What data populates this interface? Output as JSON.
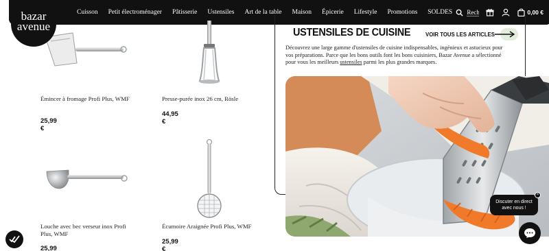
{
  "logo": {
    "line1": "bazar",
    "line2": "avenue"
  },
  "nav": {
    "items": [
      "Cuisson",
      "Petit électroménager",
      "Pâtisserie",
      "Ustensiles",
      "Art de la table",
      "Maison",
      "Épicerie",
      "Lifestyle",
      "Promotions",
      "SOLDES"
    ],
    "search_placeholder": "Rechercher",
    "cart_total": "0,00 €"
  },
  "products": [
    {
      "name": "Émincer à fromage Profi Plus, WMF",
      "price": "25,99 €"
    },
    {
      "name": "Presse-purée inox 26 cm, Rösle",
      "price": "44,95 €"
    },
    {
      "name": "Louche avec bec verseur inox Profi Plus, WMF",
      "price": "25,99 €"
    },
    {
      "name": "Écumoire Araignée Profi Plus, WMF",
      "price": "25,99 €"
    }
  ],
  "panel": {
    "title": "USTENSILES DE CUISINE",
    "see_all": "VOIR TOUS LES ARTICLES",
    "desc_before": "Découvrez une large gamme d'ustensiles de cuisine indispensables, ingénieux et astucieux pour vos préparations. Parce que les bons outils font les bons cuisiniers, Bazar Avenue a sélectionné pour vous les meilleurs ",
    "desc_link": "ustensiles",
    "desc_after": " parmi les plus grandes marques."
  },
  "chat": {
    "bubble": "Discuter en direct avec nous !"
  },
  "colors": {
    "dark": "#111111",
    "accent_green": "#e4eddc",
    "carrot": "#f07a2a"
  },
  "icons": [
    "search-icon",
    "gift-icon",
    "user-icon",
    "cart-icon",
    "arrow-right-icon",
    "chat-icon",
    "close-icon"
  ]
}
